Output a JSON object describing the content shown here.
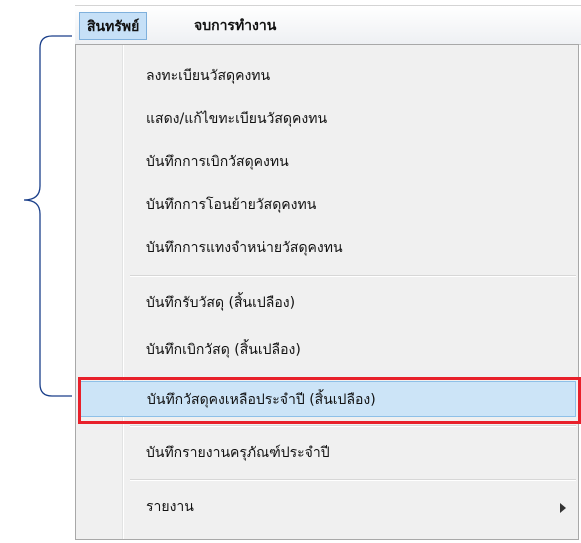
{
  "menubar": {
    "items": [
      {
        "label": "สินทรัพย์"
      },
      {
        "label": "จบการทำงาน"
      }
    ]
  },
  "menu": {
    "items": [
      {
        "label": "ลงทะเบียนวัสดุคงทน"
      },
      {
        "label": "แสดง/แก้ไขทะเบียนวัสดุคงทน"
      },
      {
        "label": "บันทึกการเบิกวัสดุคงทน"
      },
      {
        "label": "บันทึกการโอนย้ายวัสดุคงทน"
      },
      {
        "label": "บันทึกการแทงจำหน่ายวัสดุคงทน"
      },
      {
        "label": "บันทึกรับวัสดุ  (สิ้นเปลือง)"
      },
      {
        "label": "บันทึกเบิกวัสดุ  (สิ้นเปลือง)"
      },
      {
        "label": "บันทึกวัสดุคงเหลือประจำปี  (สิ้นเปลือง)"
      },
      {
        "label": "บันทึกรายงานครุภัณฑ์ประจำปี"
      },
      {
        "label": "รายงาน"
      }
    ]
  },
  "colors": {
    "highlight": "#cce4f7",
    "annotation_red": "#e8202a",
    "bracket_blue": "#1a3f8a"
  },
  "icons": {
    "submenu": "chevron-right-icon"
  }
}
